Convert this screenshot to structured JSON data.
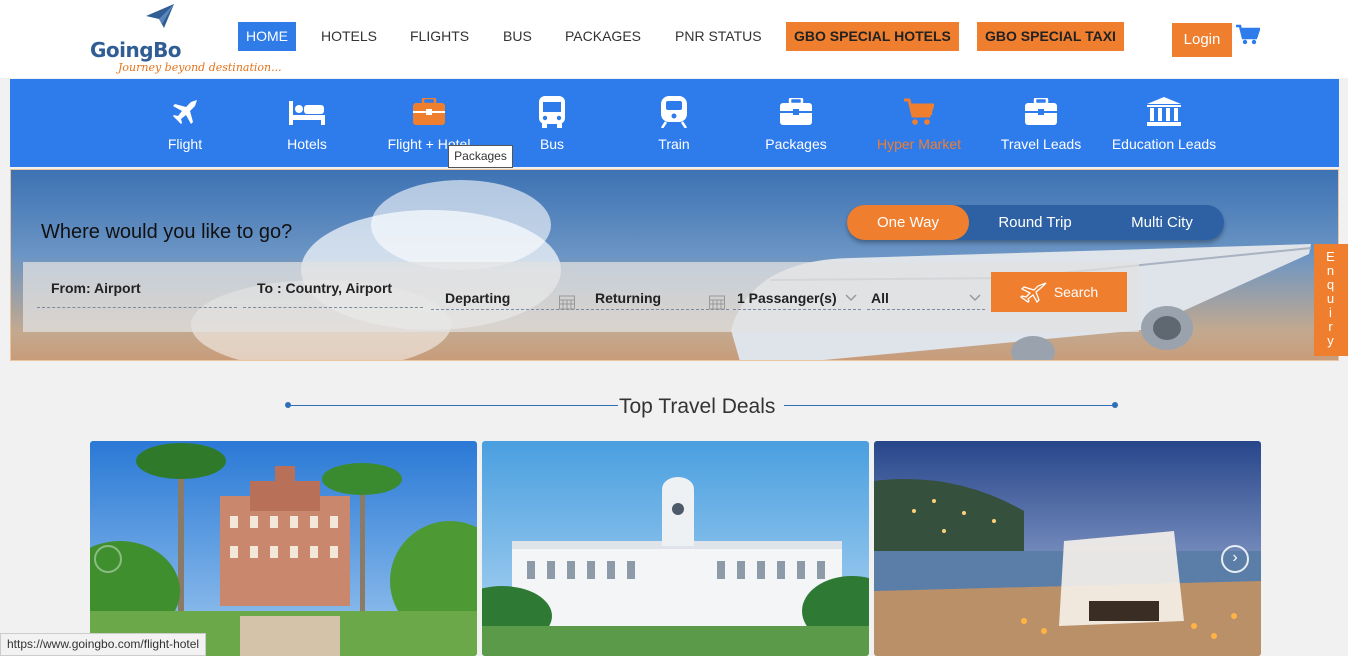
{
  "logo": {
    "name": "GoingBo",
    "tagline": "Journey beyond destination..."
  },
  "topnav": {
    "home": "HOME",
    "hotels": "HOTELS",
    "flights": "FLIGHTS",
    "bus": "BUS",
    "packages": "PACKAGES",
    "pnr": "PNR STATUS",
    "special_hotels": "GBO SPECIAL HOTELS",
    "special_taxi": "GBO SPECIAL TAXI",
    "login": "Login",
    "cart_icon": "cart-icon"
  },
  "services": [
    {
      "label": "Flight",
      "icon": "plane-icon"
    },
    {
      "label": "Hotels",
      "icon": "bed-icon"
    },
    {
      "label": "Flight + Hotel",
      "icon": "briefcase-icon"
    },
    {
      "label": "Bus",
      "icon": "bus-icon"
    },
    {
      "label": "Train",
      "icon": "train-icon"
    },
    {
      "label": "Packages",
      "icon": "briefcase-icon"
    },
    {
      "label": "Hyper Market",
      "icon": "cart-icon"
    },
    {
      "label": "Travel Leads",
      "icon": "briefcase-icon"
    },
    {
      "label": "Education Leads",
      "icon": "institution-icon"
    }
  ],
  "tooltip": "Packages",
  "hero": {
    "title": "Where would you like to go?",
    "trip_types": [
      "One Way",
      "Round Trip",
      "Multi City"
    ],
    "selected_trip": "One Way"
  },
  "search": {
    "from": "From: Airport",
    "to": "To : Country, Airport",
    "departing": "Departing",
    "returning": "Returning",
    "passengers": "1 Passanger(s)",
    "class": "All",
    "button": "Search"
  },
  "enquiry": [
    "E",
    "n",
    "q",
    "u",
    "i",
    "r",
    "y"
  ],
  "deals": {
    "title": "Top Travel Deals"
  },
  "status_url": "https://www.goingbo.com/flight-hotel",
  "colors": {
    "primary_blue": "#2e7bec",
    "accent_orange": "#ef7f2e"
  }
}
